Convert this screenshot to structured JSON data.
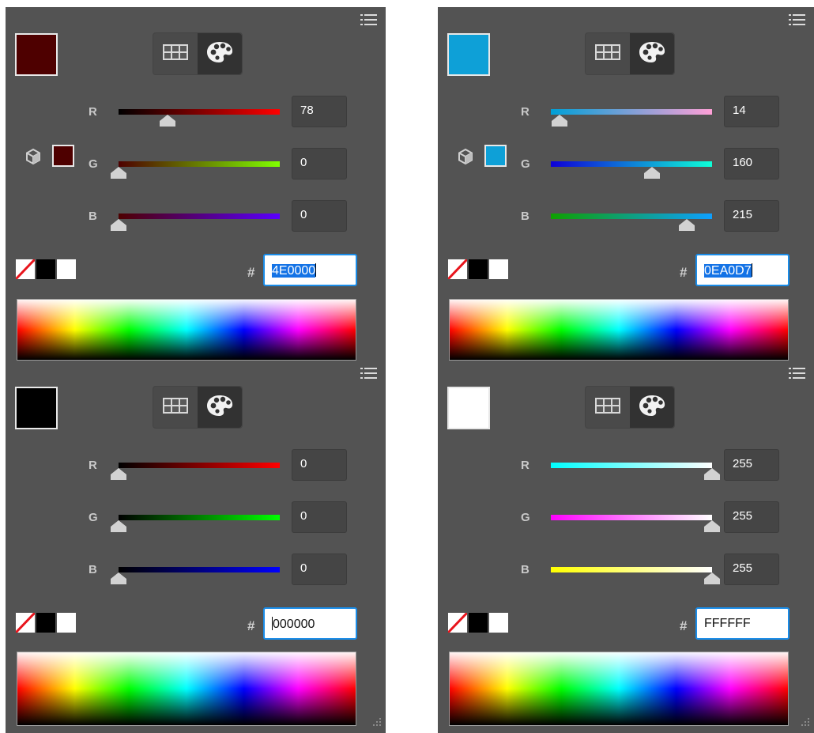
{
  "panels": [
    {
      "menu_icon": "hamburger-menu-icon",
      "swatch_color": "#4E0000",
      "cube_visible": true,
      "mode_buttons": [
        "grid-icon",
        "palette-icon"
      ],
      "channels": [
        {
          "label": "R",
          "value": "78",
          "track": "linear-gradient(to right,#000000,#ff0000)",
          "fraction": 0.306
        },
        {
          "label": "G",
          "value": "0",
          "track": "linear-gradient(to right,#4e0000,#80ff00)",
          "fraction": 0
        },
        {
          "label": "B",
          "value": "0",
          "track": "linear-gradient(to right,#4e0000,#5a00ff)",
          "fraction": 0
        }
      ],
      "hash_symbol": "#",
      "hex": {
        "selected": "4E0000",
        "rest": "",
        "caret_before": false
      }
    },
    {
      "menu_icon": "hamburger-menu-icon",
      "swatch_color": "#0EA0D7",
      "cube_visible": true,
      "mode_buttons": [
        "grid-icon",
        "palette-icon"
      ],
      "channels": [
        {
          "label": "R",
          "value": "14",
          "track": "linear-gradient(to right,#00a0d7,#ffa0d7)",
          "fraction": 0.055
        },
        {
          "label": "G",
          "value": "160",
          "track": "linear-gradient(to right,#0e00d7,#0effd7)",
          "fraction": 0.627
        },
        {
          "label": "B",
          "value": "215",
          "track": "linear-gradient(to right,#0ea000,#0ea0ff)",
          "fraction": 0.843
        }
      ],
      "hash_symbol": "#",
      "hex": {
        "selected": "0EA0D7",
        "rest": "",
        "caret_before": false
      }
    },
    {
      "menu_icon": "hamburger-menu-icon",
      "swatch_color": "#000000",
      "cube_visible": false,
      "mode_buttons": [
        "grid-icon",
        "palette-icon"
      ],
      "channels": [
        {
          "label": "R",
          "value": "0",
          "track": "linear-gradient(to right,#000000,#ff0000)",
          "fraction": 0
        },
        {
          "label": "G",
          "value": "0",
          "track": "linear-gradient(to right,#000000,#00ff00)",
          "fraction": 0
        },
        {
          "label": "B",
          "value": "0",
          "track": "linear-gradient(to right,#000000,#0000ff)",
          "fraction": 0
        }
      ],
      "hash_symbol": "#",
      "hex": {
        "selected": "",
        "rest": "000000",
        "caret_before": true
      }
    },
    {
      "menu_icon": "hamburger-menu-icon",
      "swatch_color": "#FFFFFF",
      "cube_visible": false,
      "mode_buttons": [
        "grid-icon",
        "palette-icon"
      ],
      "channels": [
        {
          "label": "R",
          "value": "255",
          "track": "linear-gradient(to right,#00ffff,#ffffff)",
          "fraction": 1
        },
        {
          "label": "G",
          "value": "255",
          "track": "linear-gradient(to right,#ff00ff,#ffffff)",
          "fraction": 1
        },
        {
          "label": "B",
          "value": "255",
          "track": "linear-gradient(to right,#ffff00,#ffffff)",
          "fraction": 1
        }
      ],
      "hash_symbol": "#",
      "hex": {
        "selected": "",
        "rest": "FFFFFF",
        "caret_before": false
      }
    }
  ]
}
